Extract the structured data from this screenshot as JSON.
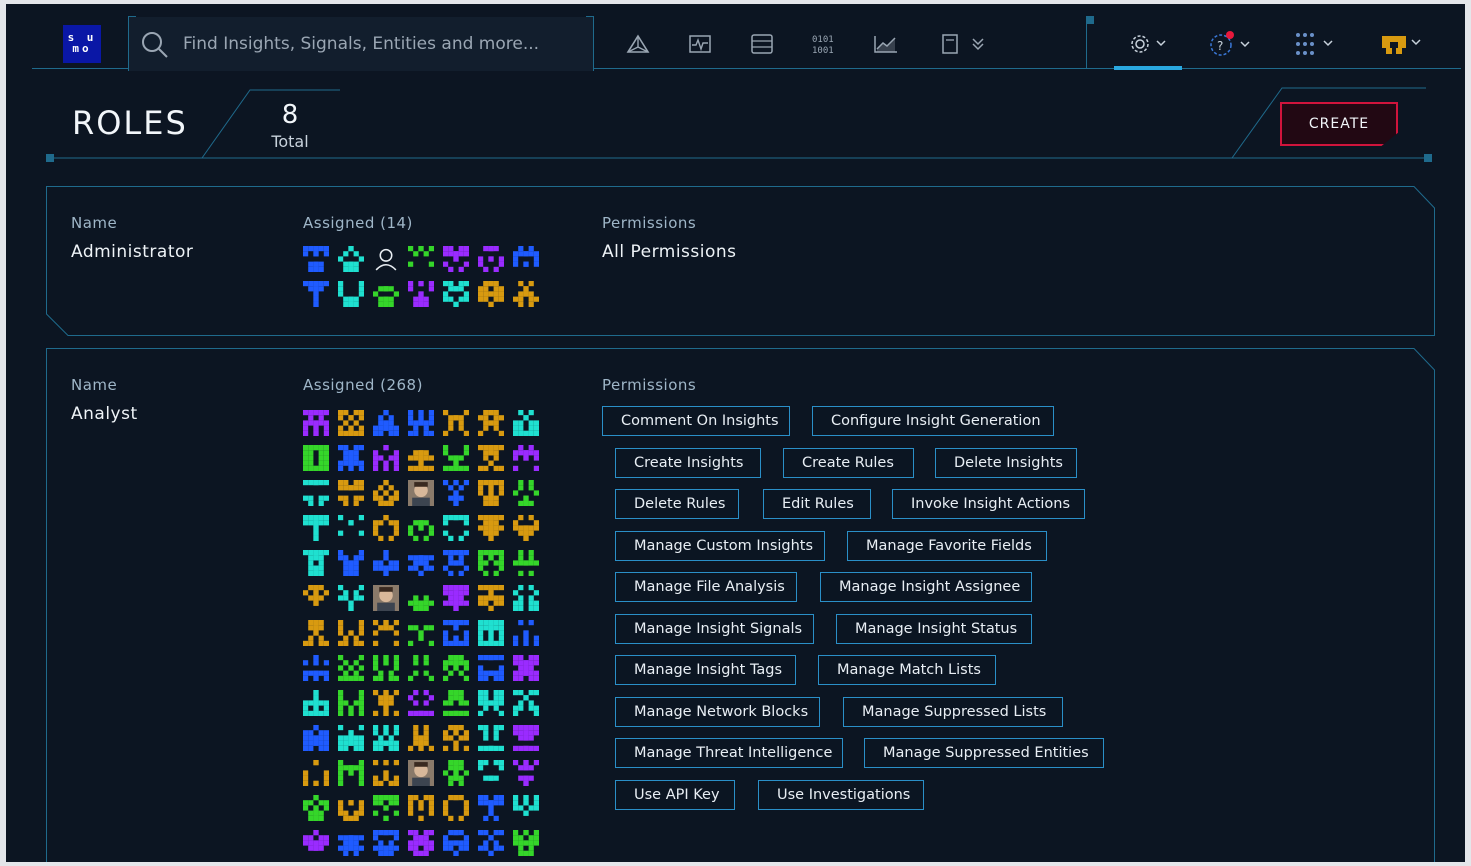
{
  "search": {
    "placeholder": "Find Insights, Signals, Entities and more..."
  },
  "nav_icons": [
    "triangle-icon",
    "pulse-icon",
    "database-icon",
    "binary-icon",
    "chart-icon",
    "notebook-icon"
  ],
  "colors": {
    "accent": "#2aa8e0",
    "border": "#1f6a8c",
    "create": "#d0143c",
    "notification": "#e8193c"
  },
  "header": {
    "title": "ROLES",
    "total": "8",
    "total_label": "Total",
    "create_label": "CREATE"
  },
  "roles": [
    {
      "name_label": "Name",
      "name": "Administrator",
      "assigned_label": "Assigned (14)",
      "permissions_label": "Permissions",
      "permissions_text": "All Permissions",
      "avatar_colors": [
        "#1f5bff",
        "#1fe0d0",
        "user",
        "#35d62a",
        "#9a2bff",
        "#9a2bff",
        "#1f5bff",
        "#1f5bff",
        "#1fe0d0",
        "#35d62a",
        "#9a2bff",
        "#1fe0d0",
        "#d89a10",
        "#d89a10"
      ]
    },
    {
      "name_label": "Name",
      "name": "Analyst",
      "assigned_label": "Assigned (268)",
      "permissions_label": "Permissions",
      "permissions": [
        [
          "Comment On Insights",
          "Configure Insight Generation"
        ],
        [
          "Create Insights",
          "Create Rules",
          "Delete Insights"
        ],
        [
          "Delete Rules",
          "Edit Rules",
          "Invoke Insight Actions"
        ],
        [
          "Manage Custom Insights",
          "Manage Favorite Fields"
        ],
        [
          "Manage File Analysis",
          "Manage Insight Assignee"
        ],
        [
          "Manage Insight Signals",
          "Manage Insight Status"
        ],
        [
          "Manage Insight Tags",
          "Manage Match Lists"
        ],
        [
          "Manage Network Blocks",
          "Manage Suppressed Lists"
        ],
        [
          "Manage Threat Intelligence",
          "Manage Suppressed Entities"
        ],
        [
          "Use API Key",
          "Use Investigations"
        ]
      ],
      "avatar_colors": [
        "#9a2bff",
        "#d89a10",
        "#1f5bff",
        "#1f5bff",
        "#d89a10",
        "#d89a10",
        "#1fe0d0",
        "#35d62a",
        "#1f5bff",
        "#9a2bff",
        "#d89a10",
        "#35d62a",
        "#d89a10",
        "#9a2bff",
        "#1fe0d0",
        "#d89a10",
        "#d89a10",
        "photo",
        "#1f5bff",
        "#d89a10",
        "#35d62a",
        "#1fe0d0",
        "#1fe0d0",
        "#d89a10",
        "#35d62a",
        "#1fe0d0",
        "#d89a10",
        "#d89a10",
        "#1fe0d0",
        "#1f5bff",
        "#1f5bff",
        "#1f5bff",
        "#1f5bff",
        "#35d62a",
        "#35d62a",
        "#d89a10",
        "#1fe0d0",
        "photo",
        "#35d62a",
        "#9a2bff",
        "#d89a10",
        "#1fe0d0",
        "#d89a10",
        "#d89a10",
        "#d89a10",
        "#35d62a",
        "#1f5bff",
        "#1fe0d0",
        "#1f5bff",
        "#1f5bff",
        "#35d62a",
        "#35d62a",
        "#35d62a",
        "#35d62a",
        "#1f5bff",
        "#9a2bff",
        "#1fe0d0",
        "#35d62a",
        "#d89a10",
        "#9a2bff",
        "#35d62a",
        "#1fe0d0",
        "#1fe0d0",
        "#1f5bff",
        "#1fe0d0",
        "#1fe0d0",
        "#d89a10",
        "#d89a10",
        "#1fe0d0",
        "#9a2bff",
        "#d89a10",
        "#35d62a",
        "#d89a10",
        "photo",
        "#35d62a",
        "#1fe0d0",
        "#9a2bff",
        "#35d62a",
        "#d89a10",
        "#35d62a",
        "#d89a10",
        "#d89a10",
        "#1f5bff",
        "#1fe0d0",
        "#9a2bff",
        "#1f5bff",
        "#1f5bff",
        "#9a2bff",
        "#1f5bff",
        "#1f5bff",
        "#35d62a"
      ]
    }
  ]
}
